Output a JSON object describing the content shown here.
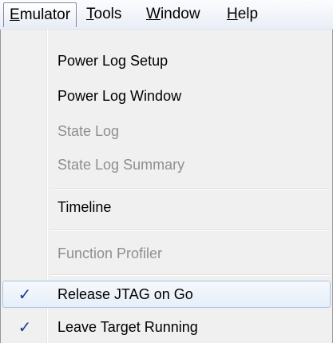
{
  "menubar": {
    "items": [
      {
        "mnemonic": "E",
        "rest": "mulator",
        "active": true
      },
      {
        "mnemonic": "T",
        "rest": "ools",
        "active": false
      },
      {
        "mnemonic": "W",
        "rest": "indow",
        "active": false
      },
      {
        "mnemonic": "H",
        "rest": "elp",
        "active": false
      }
    ]
  },
  "dropdown": {
    "items": [
      {
        "label": "Power Log Setup",
        "enabled": true,
        "checked": false
      },
      {
        "label": "Power Log Window",
        "enabled": true,
        "checked": false
      },
      {
        "label": "State Log",
        "enabled": false,
        "checked": false
      },
      {
        "label": "State Log Summary",
        "enabled": false,
        "checked": false
      },
      {
        "label": "Timeline",
        "enabled": true,
        "checked": false
      },
      {
        "label": "Function Profiler",
        "enabled": false,
        "checked": false
      },
      {
        "label": "Release JTAG on Go",
        "enabled": true,
        "checked": true,
        "highlighted": true
      },
      {
        "label": "Leave Target Running",
        "enabled": true,
        "checked": true
      }
    ],
    "check_glyph": "✓",
    "check_color": "#1c3c8c",
    "disabled_text_color": "#8f8f8f",
    "highlight_border_color": "#a8c4e6"
  }
}
